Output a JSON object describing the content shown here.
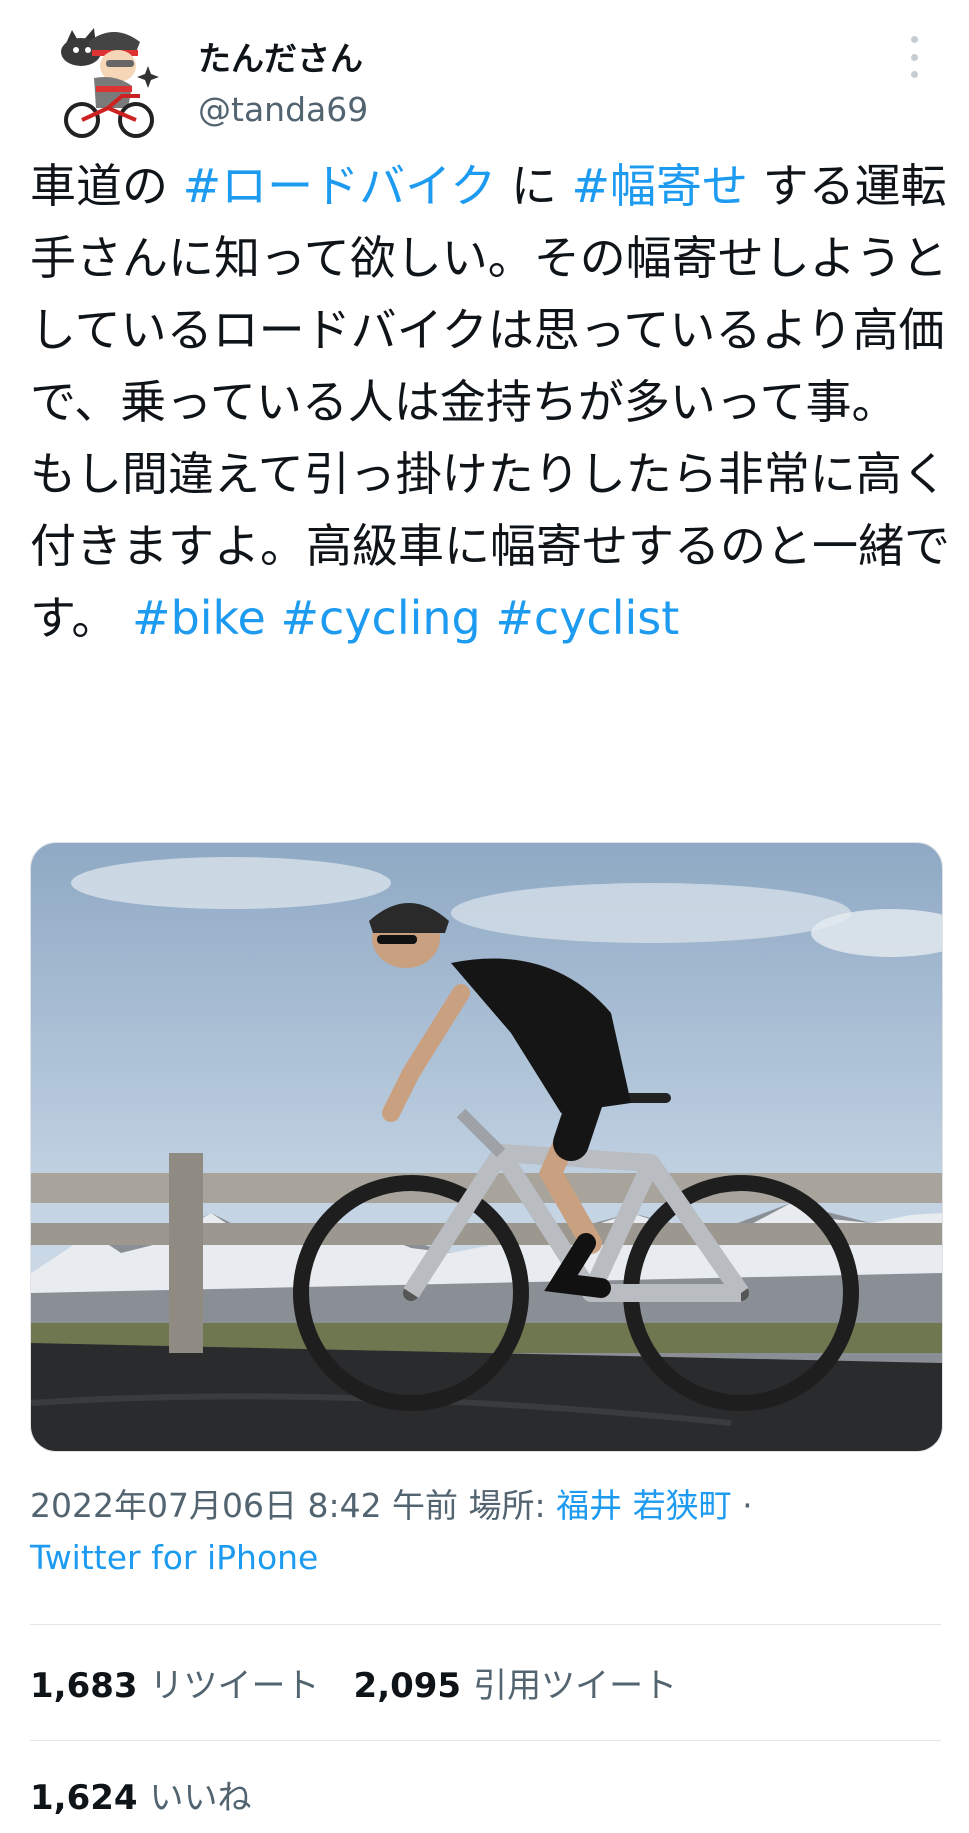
{
  "header": {
    "display_name": "たんださん",
    "handle": "@tanda69",
    "more_icon": "more-vertical-icon"
  },
  "tweet": {
    "line1_prefix": "車道の ",
    "tag_roadbike": "#ロードバイク",
    "line1_mid": " に ",
    "tag_habayose": "#幅寄せ",
    "body": " する運転手さんに知って欲しい。その幅寄せしようとしているロードバイクは思っているより高価で、乗っている人は金持ちが多いって事。",
    "body2": "もし間違えて引っ掛けたりしたら非常に高く付きますよ。高級車に幅寄せするのと一緒です。 ",
    "tag_bike": "#bike",
    "tag_cycling": "#cycling",
    "tag_cyclist": "#cyclist"
  },
  "meta": {
    "datetime": "2022年07月06日 8:42 午前",
    "location_label": " 場所: ",
    "location": "福井 若狭町",
    "separator": " ·",
    "source": "Twitter for iPhone"
  },
  "stats": {
    "retweets_count": "1,683",
    "retweets_label": "リツイート",
    "quotes_count": "2,095",
    "quotes_label": "引用ツイート",
    "likes_count": "1,624",
    "likes_label": "いいね"
  },
  "colors": {
    "accent": "#1d9bf0",
    "secondary_text": "#536471",
    "primary_text": "#0f1419"
  }
}
